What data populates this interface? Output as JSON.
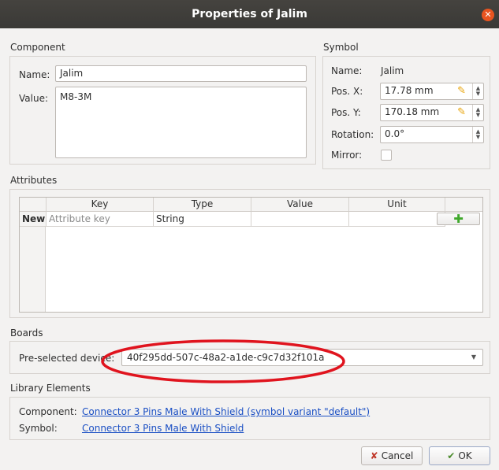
{
  "window": {
    "title": "Properties of Jalim"
  },
  "component": {
    "section_label": "Component",
    "name_label": "Name:",
    "name_value": "Jalim",
    "value_label": "Value:",
    "value_text": "M8-3M"
  },
  "symbol": {
    "section_label": "Symbol",
    "name_label": "Name:",
    "name_value": "Jalim",
    "posx_label": "Pos. X:",
    "posx_value": "17.78 mm",
    "posy_label": "Pos. Y:",
    "posy_value": "170.18 mm",
    "rotation_label": "Rotation:",
    "rotation_value": "0.0°",
    "mirror_label": "Mirror:",
    "mirror_checked": false
  },
  "attributes": {
    "section_label": "Attributes",
    "columns": [
      "Key",
      "Type",
      "Value",
      "Unit"
    ],
    "new_row": {
      "row_label": "New:",
      "key_placeholder": "Attribute key",
      "type": "String",
      "value": "",
      "unit": "",
      "add_icon": "plus-icon"
    }
  },
  "boards": {
    "section_label": "Boards",
    "device_label": "Pre-selected device:",
    "device_value": "40f295dd-507c-48a2-a1de-c9c7d32f101a"
  },
  "library": {
    "section_label": "Library Elements",
    "component_label": "Component:",
    "component_link": "Connector 3 Pins Male With Shield (symbol variant \"default\")",
    "symbol_label": "Symbol:",
    "symbol_link": "Connector 3 Pins Male With Shield"
  },
  "buttons": {
    "cancel_label": "Cancel",
    "ok_label": "OK"
  },
  "colors": {
    "titlebar": "#3c3b37",
    "close": "#e95420",
    "link": "#1a4fc4",
    "annotation": "#e0141e",
    "add_icon": "#3fa82b",
    "edit_icon": "#e8a40a"
  }
}
